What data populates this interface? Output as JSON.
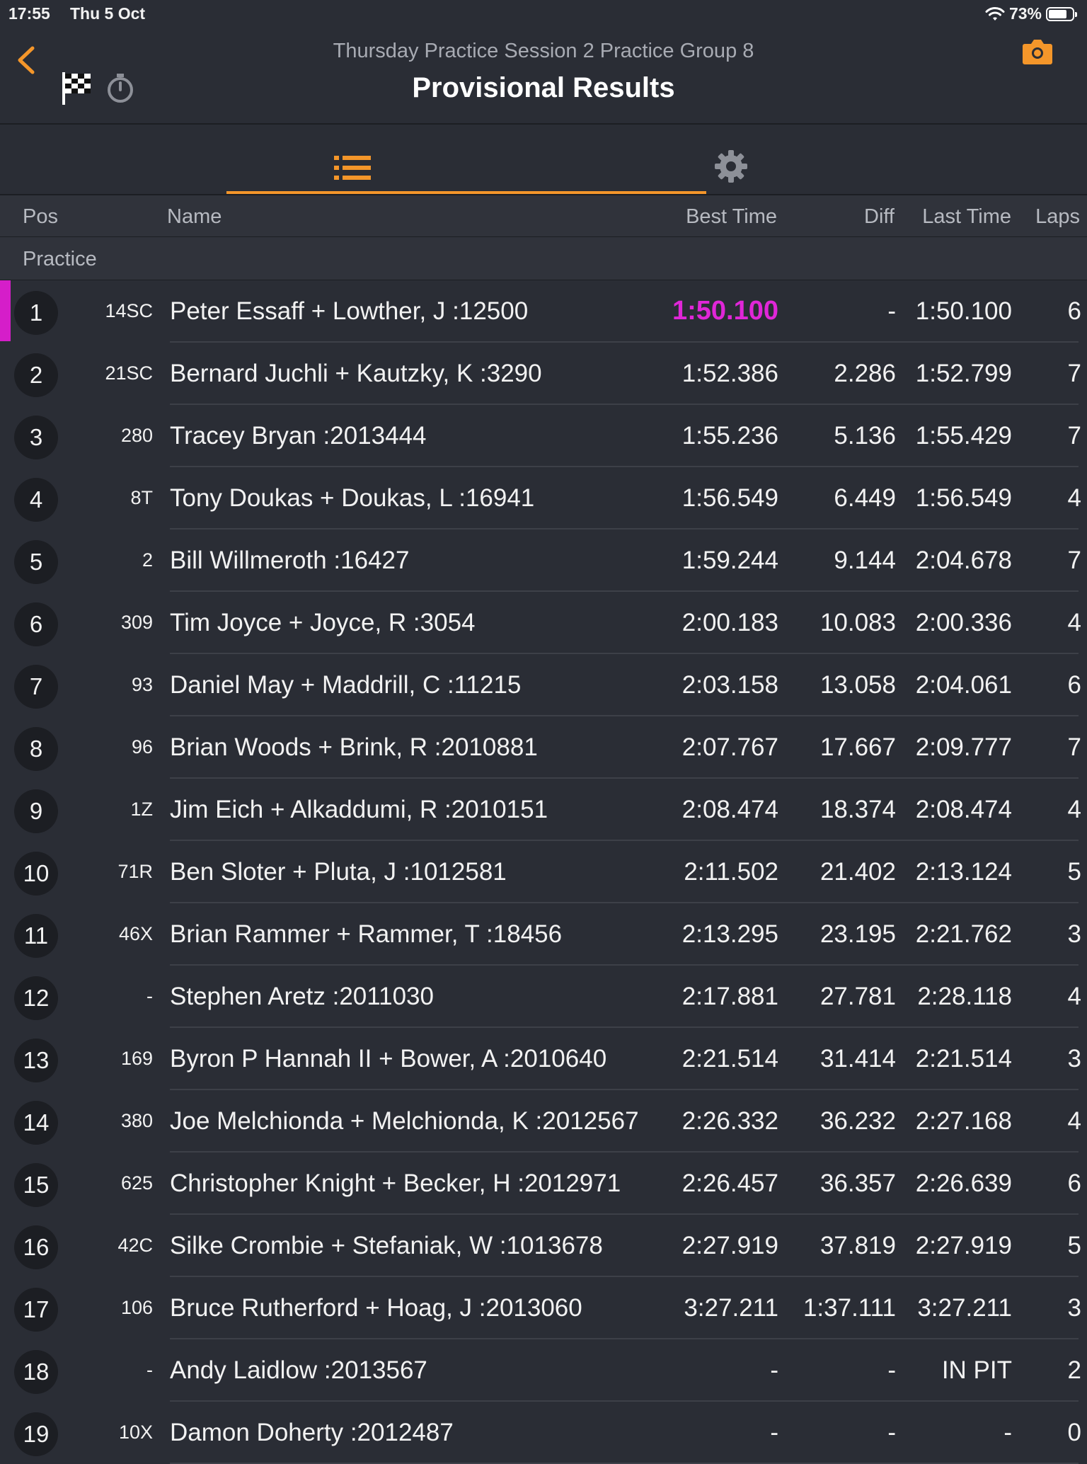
{
  "status_bar": {
    "time": "17:55",
    "date": "Thu 5 Oct",
    "battery": "73%"
  },
  "header": {
    "subtitle": "Thursday Practice Session 2 Practice Group 8",
    "title": "Provisional Results"
  },
  "columns": {
    "pos": "Pos",
    "name": "Name",
    "best_time": "Best Time",
    "diff": "Diff",
    "last_time": "Last Time",
    "laps": "Laps"
  },
  "section": "Practice",
  "colors": {
    "accent": "#f4962a",
    "fastest": "#e026d8",
    "background": "#2a2d35"
  },
  "rows": [
    {
      "pos": "1",
      "num": "14SC",
      "name": "Peter Essaff + Lowther, J :12500",
      "best": "1:50.100",
      "diff": "-",
      "last": "1:50.100",
      "laps": "6",
      "fastest": true
    },
    {
      "pos": "2",
      "num": "21SC",
      "name": "Bernard Juchli + Kautzky, K :3290",
      "best": "1:52.386",
      "diff": "2.286",
      "last": "1:52.799",
      "laps": "7"
    },
    {
      "pos": "3",
      "num": "280",
      "name": "Tracey Bryan :2013444",
      "best": "1:55.236",
      "diff": "5.136",
      "last": "1:55.429",
      "laps": "7"
    },
    {
      "pos": "4",
      "num": "8T",
      "name": "Tony Doukas + Doukas, L :16941",
      "best": "1:56.549",
      "diff": "6.449",
      "last": "1:56.549",
      "laps": "4"
    },
    {
      "pos": "5",
      "num": "2",
      "name": "Bill Willmeroth :16427",
      "best": "1:59.244",
      "diff": "9.144",
      "last": "2:04.678",
      "laps": "7"
    },
    {
      "pos": "6",
      "num": "309",
      "name": "Tim Joyce + Joyce, R :3054",
      "best": "2:00.183",
      "diff": "10.083",
      "last": "2:00.336",
      "laps": "4"
    },
    {
      "pos": "7",
      "num": "93",
      "name": "Daniel May + Maddrill, C :11215",
      "best": "2:03.158",
      "diff": "13.058",
      "last": "2:04.061",
      "laps": "6"
    },
    {
      "pos": "8",
      "num": "96",
      "name": "Brian Woods + Brink, R :2010881",
      "best": "2:07.767",
      "diff": "17.667",
      "last": "2:09.777",
      "laps": "7"
    },
    {
      "pos": "9",
      "num": "1Z",
      "name": "Jim Eich + Alkaddumi, R :2010151",
      "best": "2:08.474",
      "diff": "18.374",
      "last": "2:08.474",
      "laps": "4"
    },
    {
      "pos": "10",
      "num": "71R",
      "name": "Ben Sloter + Pluta, J :1012581",
      "best": "2:11.502",
      "diff": "21.402",
      "last": "2:13.124",
      "laps": "5"
    },
    {
      "pos": "11",
      "num": "46X",
      "name": "Brian Rammer + Rammer, T :18456",
      "best": "2:13.295",
      "diff": "23.195",
      "last": "2:21.762",
      "laps": "3"
    },
    {
      "pos": "12",
      "num": "-",
      "name": "Stephen Aretz :2011030",
      "best": "2:17.881",
      "diff": "27.781",
      "last": "2:28.118",
      "laps": "4"
    },
    {
      "pos": "13",
      "num": "169",
      "name": "Byron P Hannah II + Bower, A :2010640",
      "best": "2:21.514",
      "diff": "31.414",
      "last": "2:21.514",
      "laps": "3"
    },
    {
      "pos": "14",
      "num": "380",
      "name": "Joe Melchionda + Melchionda, K :2012567",
      "best": "2:26.332",
      "diff": "36.232",
      "last": "2:27.168",
      "laps": "4"
    },
    {
      "pos": "15",
      "num": "625",
      "name": "Christopher Knight + Becker, H :2012971",
      "best": "2:26.457",
      "diff": "36.357",
      "last": "2:26.639",
      "laps": "6"
    },
    {
      "pos": "16",
      "num": "42C",
      "name": "Silke Crombie + Stefaniak, W :1013678",
      "best": "2:27.919",
      "diff": "37.819",
      "last": "2:27.919",
      "laps": "5"
    },
    {
      "pos": "17",
      "num": "106",
      "name": "Bruce Rutherford + Hoag, J :2013060",
      "best": "3:27.211",
      "diff": "1:37.111",
      "last": "3:27.211",
      "laps": "3"
    },
    {
      "pos": "18",
      "num": "-",
      "name": "Andy Laidlow :2013567",
      "best": "-",
      "diff": "-",
      "last": "IN PIT",
      "laps": "2"
    },
    {
      "pos": "19",
      "num": "10X",
      "name": "Damon Doherty :2012487",
      "best": "-",
      "diff": "-",
      "last": "-",
      "laps": "0"
    }
  ]
}
